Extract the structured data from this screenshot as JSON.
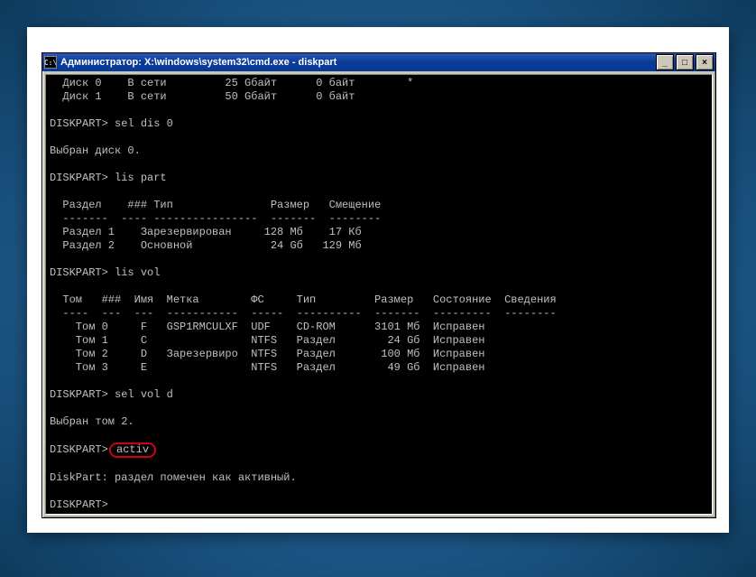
{
  "window": {
    "title": "Администратор: X:\\windows\\system32\\cmd.exe - diskpart",
    "icon_label": "C:\\"
  },
  "btns": {
    "min": "_",
    "max": "□",
    "close": "×"
  },
  "term": {
    "disk_hdr": "  Диск 0    В сети         25 Gбайт      0 байт        *",
    "disk_row2": "  Диск 1    В сети         50 Gбайт      0 байт",
    "p1": "DISKPART> ",
    "cmd1": "sel dis 0",
    "resp1": "Выбран диск 0.",
    "cmd2": "lis part",
    "part_head": "  Раздел    ### Тип               Размер   Смещение",
    "part_rule": "  -------  ---- ----------------  -------  --------",
    "part_row1": "  Раздел 1    Зарезервирован     128 Мб    17 Кб",
    "part_row2": "  Раздел 2    Основной            24 Gб   129 Мб",
    "cmd3": "lis vol",
    "vol_head": "  Том   ###  Имя  Метка        ФС     Тип         Размер   Состояние  Сведения",
    "vol_rule": "  ----  ---  ---  -----------  -----  ----------  -------  ---------  --------",
    "vol_row0": "    Том 0     F   GSP1RMCULXF  UDF    CD-ROM      3101 Мб  Исправен",
    "vol_row1": "    Том 1     C                NTFS   Раздел        24 Gб  Исправен",
    "vol_row2": "    Том 2     D   Зарезервиро  NTFS   Раздел       100 Мб  Исправен",
    "vol_row3": "    Том 3     E                NTFS   Раздел        49 Gб  Исправен",
    "cmd4": "sel vol d",
    "resp4": "Выбран том 2.",
    "cmd5": "activ",
    "resp5": "DiskPart: раздел помечен как активный.",
    "final_prompt": "DISKPART> "
  }
}
